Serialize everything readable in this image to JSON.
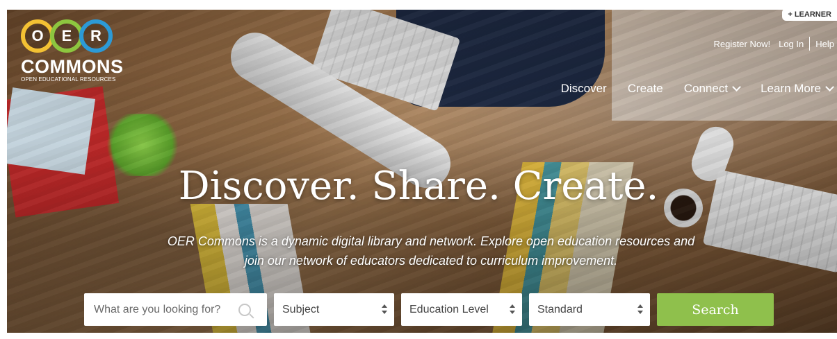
{
  "brand": {
    "circles": [
      {
        "letter": "O",
        "color": "#f3c133"
      },
      {
        "letter": "E",
        "color": "#8dc63f"
      },
      {
        "letter": "R",
        "color": "#2c9ad6"
      }
    ],
    "name": "COMMONS",
    "tagline": "OPEN EDUCATIONAL RESOURCES"
  },
  "header": {
    "learner_tab": "+ LEARNER",
    "register": "Register Now!",
    "login": "Log In",
    "help": "Help"
  },
  "nav": {
    "discover": "Discover",
    "create": "Create",
    "connect": "Connect",
    "learn_more": "Learn More"
  },
  "hero": {
    "title": "Discover. Share. Create.",
    "description_line1": "OER Commons is a dynamic digital library and network. Explore open education resources and",
    "description_line2": "join our network of educators dedicated to curriculum improvement."
  },
  "search": {
    "placeholder": "What are you looking for?",
    "subject": "Subject",
    "education_level": "Education Level",
    "standard": "Standard",
    "button": "Search"
  },
  "colors": {
    "search_button": "#8fc04c"
  },
  "icons": {
    "search": "magnifier-icon",
    "dropdown": "chevron-down-icon",
    "select": "up-down-arrows-icon"
  }
}
